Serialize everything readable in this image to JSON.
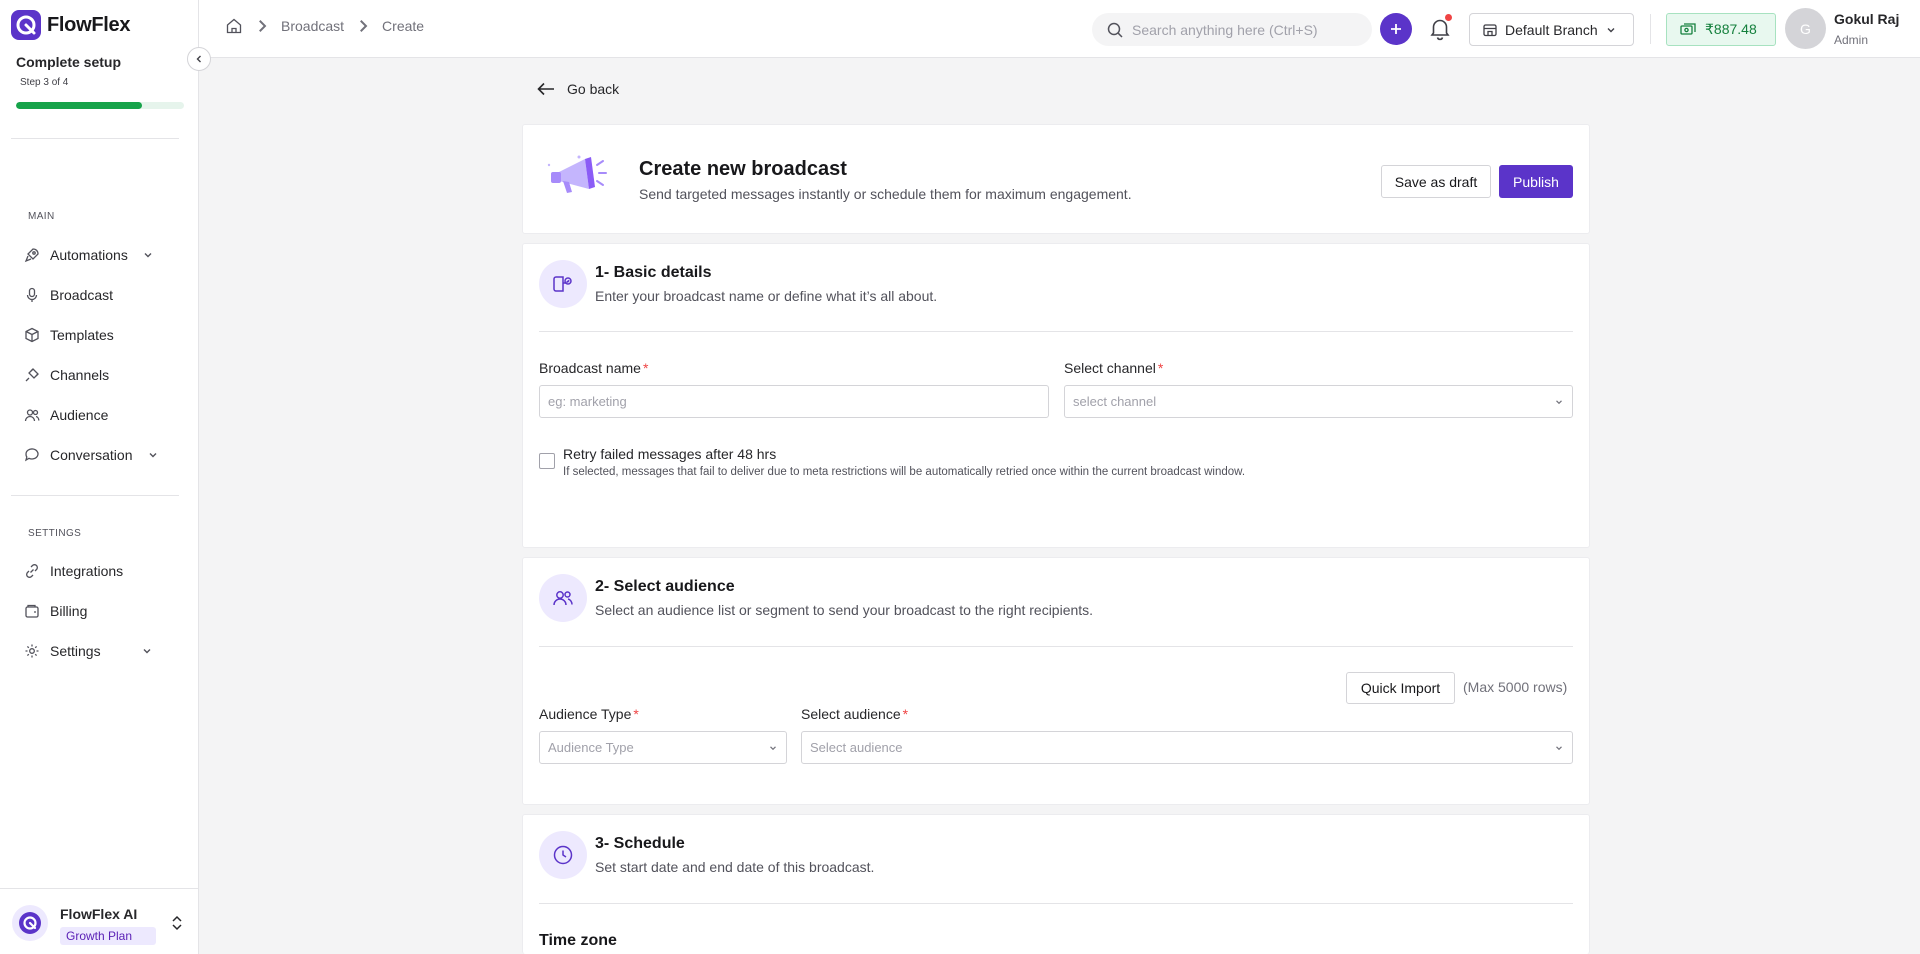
{
  "app": {
    "name": "FlowFlex"
  },
  "setup": {
    "title": "Complete setup",
    "step": "Step 3 of 4",
    "progress_fraction": 0.75
  },
  "sidebar": {
    "main_label": "MAIN",
    "settings_label": "SETTINGS",
    "main_items": [
      {
        "label": "Automations",
        "icon": "rocket-icon",
        "expandable": true
      },
      {
        "label": "Broadcast",
        "icon": "microphone-icon",
        "expandable": false
      },
      {
        "label": "Templates",
        "icon": "box-icon",
        "expandable": false
      },
      {
        "label": "Channels",
        "icon": "plug-icon",
        "expandable": false
      },
      {
        "label": "Audience",
        "icon": "users-icon",
        "expandable": false
      },
      {
        "label": "Conversation",
        "icon": "chat-icon",
        "expandable": true
      }
    ],
    "settings_items": [
      {
        "label": "Integrations",
        "icon": "link-icon",
        "expandable": false
      },
      {
        "label": "Billing",
        "icon": "wallet-icon",
        "expandable": false
      },
      {
        "label": "Settings",
        "icon": "gear-icon",
        "expandable": true
      }
    ],
    "footer": {
      "name": "FlowFlex AI",
      "plan": "Growth Plan"
    }
  },
  "header": {
    "breadcrumbs": [
      "Broadcast",
      "Create"
    ],
    "search_placeholder": "Search anything here (Ctrl+S)",
    "branch": "Default Branch",
    "wallet_balance": "₹887.48",
    "user": {
      "initial": "G",
      "name": "Gokul Raj",
      "role": "Admin"
    }
  },
  "page": {
    "go_back": "Go back",
    "title": "Create new broadcast",
    "subtitle": "Send targeted messages instantly or schedule them for maximum engagement.",
    "save_draft": "Save as draft",
    "publish": "Publish"
  },
  "basic": {
    "title": "1- Basic details",
    "subtitle": "Enter your broadcast name or define what it’s all about.",
    "name_label": "Broadcast name",
    "name_placeholder": "eg: marketing",
    "channel_label": "Select channel",
    "channel_placeholder": "select channel",
    "retry_label": "Retry failed messages after 48 hrs",
    "retry_hint": "If selected, messages that fail to deliver due to meta restrictions will be automatically retried once within the current broadcast window."
  },
  "audience": {
    "title": "2- Select audience",
    "subtitle": "Select an audience list or segment to send your broadcast to the right recipients.",
    "quick_import": "Quick Import",
    "max_rows": "(Max 5000 rows)",
    "type_label": "Audience Type",
    "type_placeholder": "Audience Type",
    "select_label": "Select audience",
    "select_placeholder": "Select audience"
  },
  "schedule": {
    "title": "3- Schedule",
    "subtitle": "Set start date and end date of this broadcast.",
    "timezone_label": "Time zone"
  },
  "colors": {
    "primary": "#5b34c9",
    "success": "#16a34a",
    "required": "#ef4444"
  }
}
